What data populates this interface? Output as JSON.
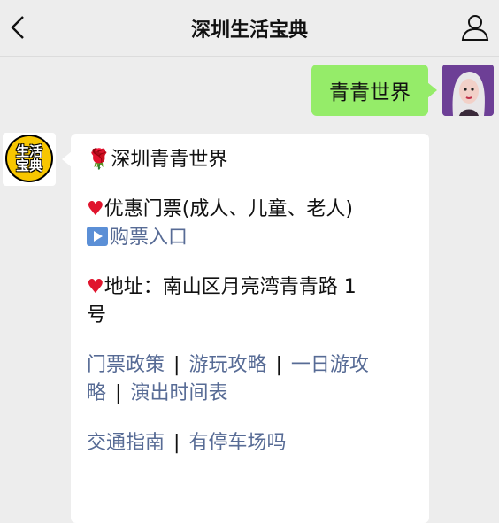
{
  "header": {
    "title": "深圳生活宝典"
  },
  "me": {
    "message": "青青世界"
  },
  "bot": {
    "avatar_text_top": "生活",
    "avatar_text_bottom": "宝典",
    "heading": "深圳青青世界",
    "ticket_label": "优惠门票(成人、儿童、老人)",
    "buy_link": "购票入口",
    "address": "地址：南山区月亮湾青青路 1",
    "address_cont": "号",
    "links_row1": [
      "门票政策",
      "游玩攻略",
      "一日游攻"
    ],
    "links_row2": [
      "略",
      "演出时间表"
    ],
    "links_row3": [
      "交通指南",
      "有停车场吗"
    ]
  },
  "colors": {
    "link": "#576b95",
    "my_bubble": "#95ec69",
    "bg": "#ededed"
  }
}
